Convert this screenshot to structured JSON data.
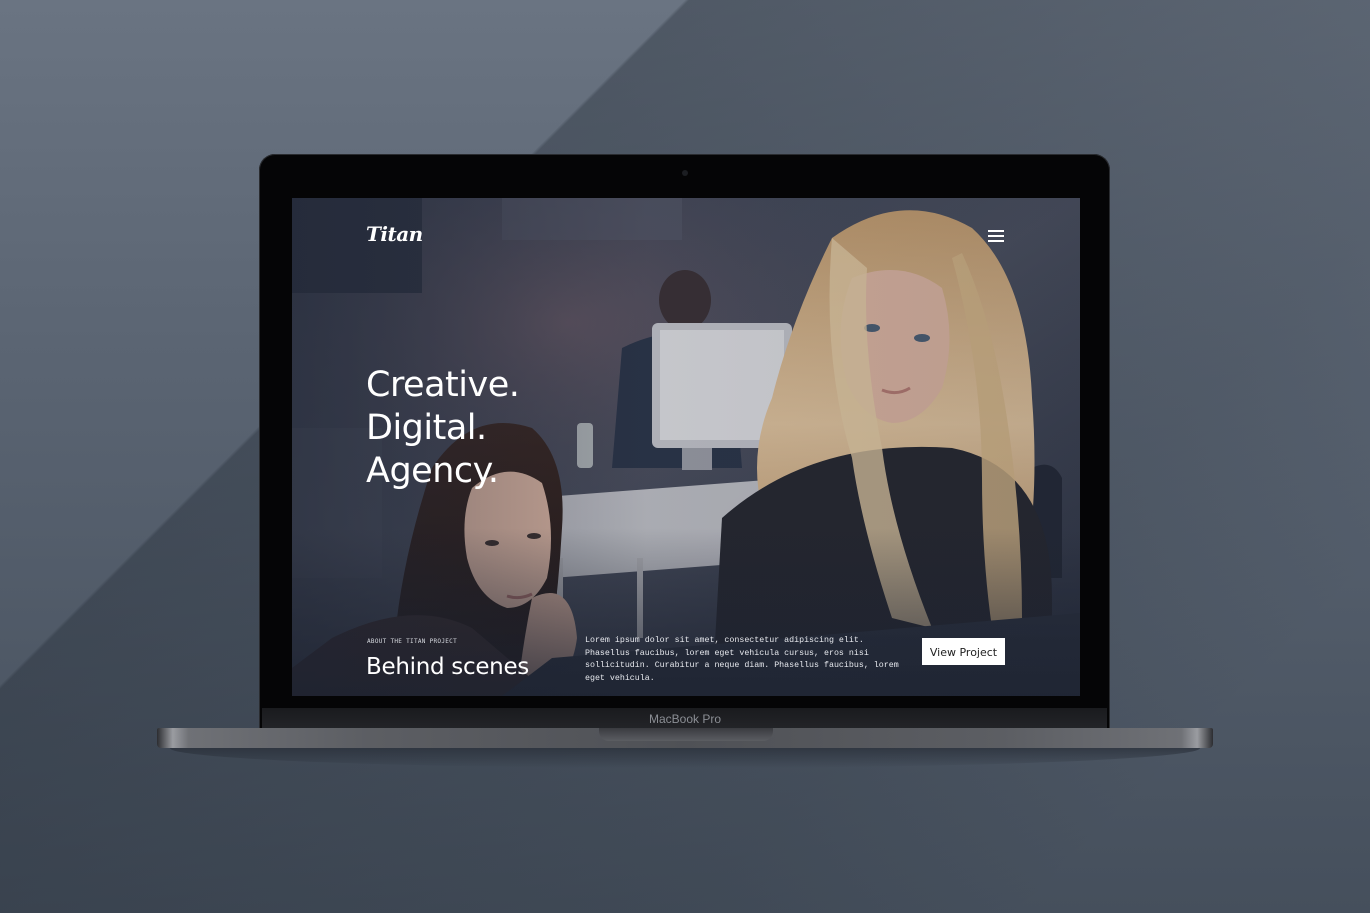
{
  "device": {
    "label": "MacBook Pro"
  },
  "site": {
    "logo": "Titan",
    "menu_icon": "hamburger-menu-icon",
    "hero": {
      "lines": [
        "Creative.",
        "Digital.",
        "Agency."
      ]
    },
    "project": {
      "eyebrow": "ABOUT THE TITAN PROJECT",
      "title": "Behind scenes",
      "description": "Lorem ipsum dolor sit amet, consectetur adipiscing elit. Phasellus faucibus, lorem eget vehicula cursus, eros nisi sollicitudin. Curabitur a neque diam. Phasellus faucibus, lorem eget vehicula.",
      "cta_label": "View Project"
    }
  },
  "colors": {
    "background": "#5a6472",
    "screen_text": "#ffffff",
    "button_bg": "#ffffff",
    "button_text": "#222222"
  }
}
